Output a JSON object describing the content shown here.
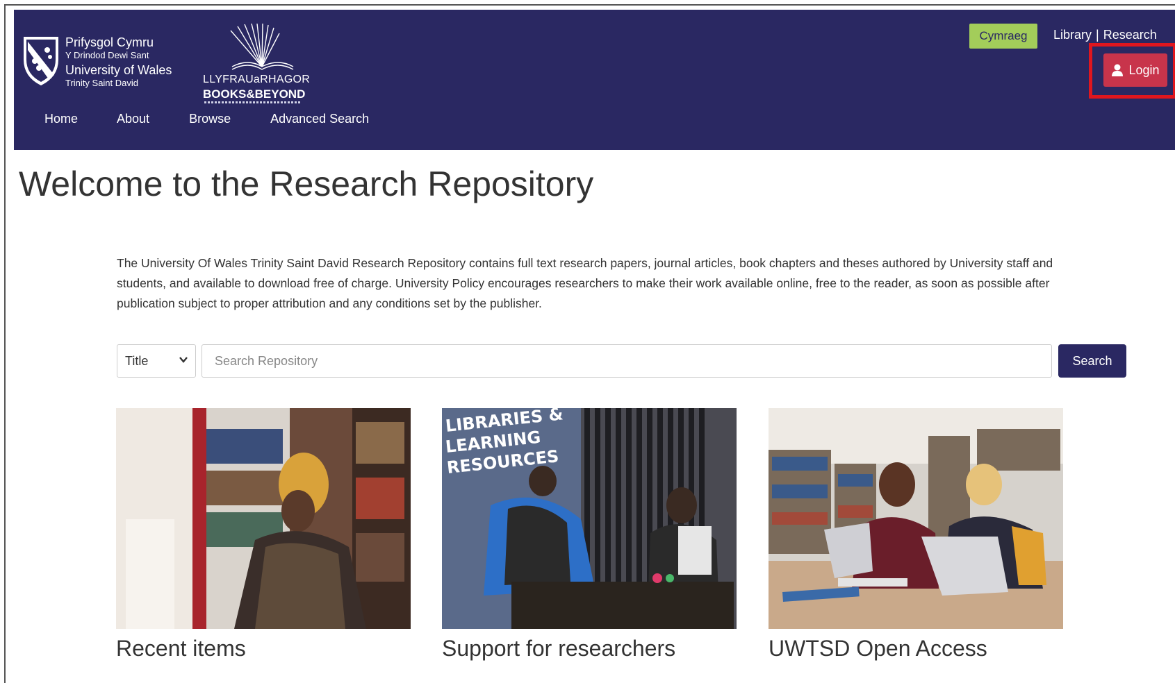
{
  "header": {
    "university": {
      "line1": "Prifysgol Cymru",
      "line2": "Y Drindod Dewi Sant",
      "line3": "University of Wales",
      "line4": "Trinity Saint David"
    },
    "books_beyond": {
      "line1": "LLYFRAUaRHAGOR",
      "line2": "BOOKS&BEYOND"
    },
    "language_button": "Cymraeg",
    "top_links": [
      "Library",
      "Research"
    ],
    "top_links_separator": "|",
    "login_label": "Login",
    "nav": [
      "Home",
      "About",
      "Browse",
      "Advanced Search"
    ]
  },
  "main": {
    "title": "Welcome to the Research Repository",
    "intro": "The University Of Wales Trinity Saint David Research Repository contains full text research papers, journal articles, book chapters and theses authored by University staff and students, and available to download free of charge. University Policy encourages researchers to make their work available online, free to the reader, as soon as possible after publication subject to proper attribution and any conditions set by the publisher.",
    "search": {
      "field_selected": "Title",
      "placeholder": "Search Repository",
      "button": "Search"
    },
    "cards": [
      {
        "caption": "Recent items"
      },
      {
        "caption": "Support for researchers",
        "image_text": "LIBRARIES & LEARNING RESOURCES"
      },
      {
        "caption": "UWTSD Open Access"
      }
    ]
  },
  "colors": {
    "header_bg": "#2a2862",
    "language_button": "#a3cd5a",
    "login_button": "#c8344b",
    "highlight_box": "#e0161e",
    "search_button": "#2a2862"
  }
}
